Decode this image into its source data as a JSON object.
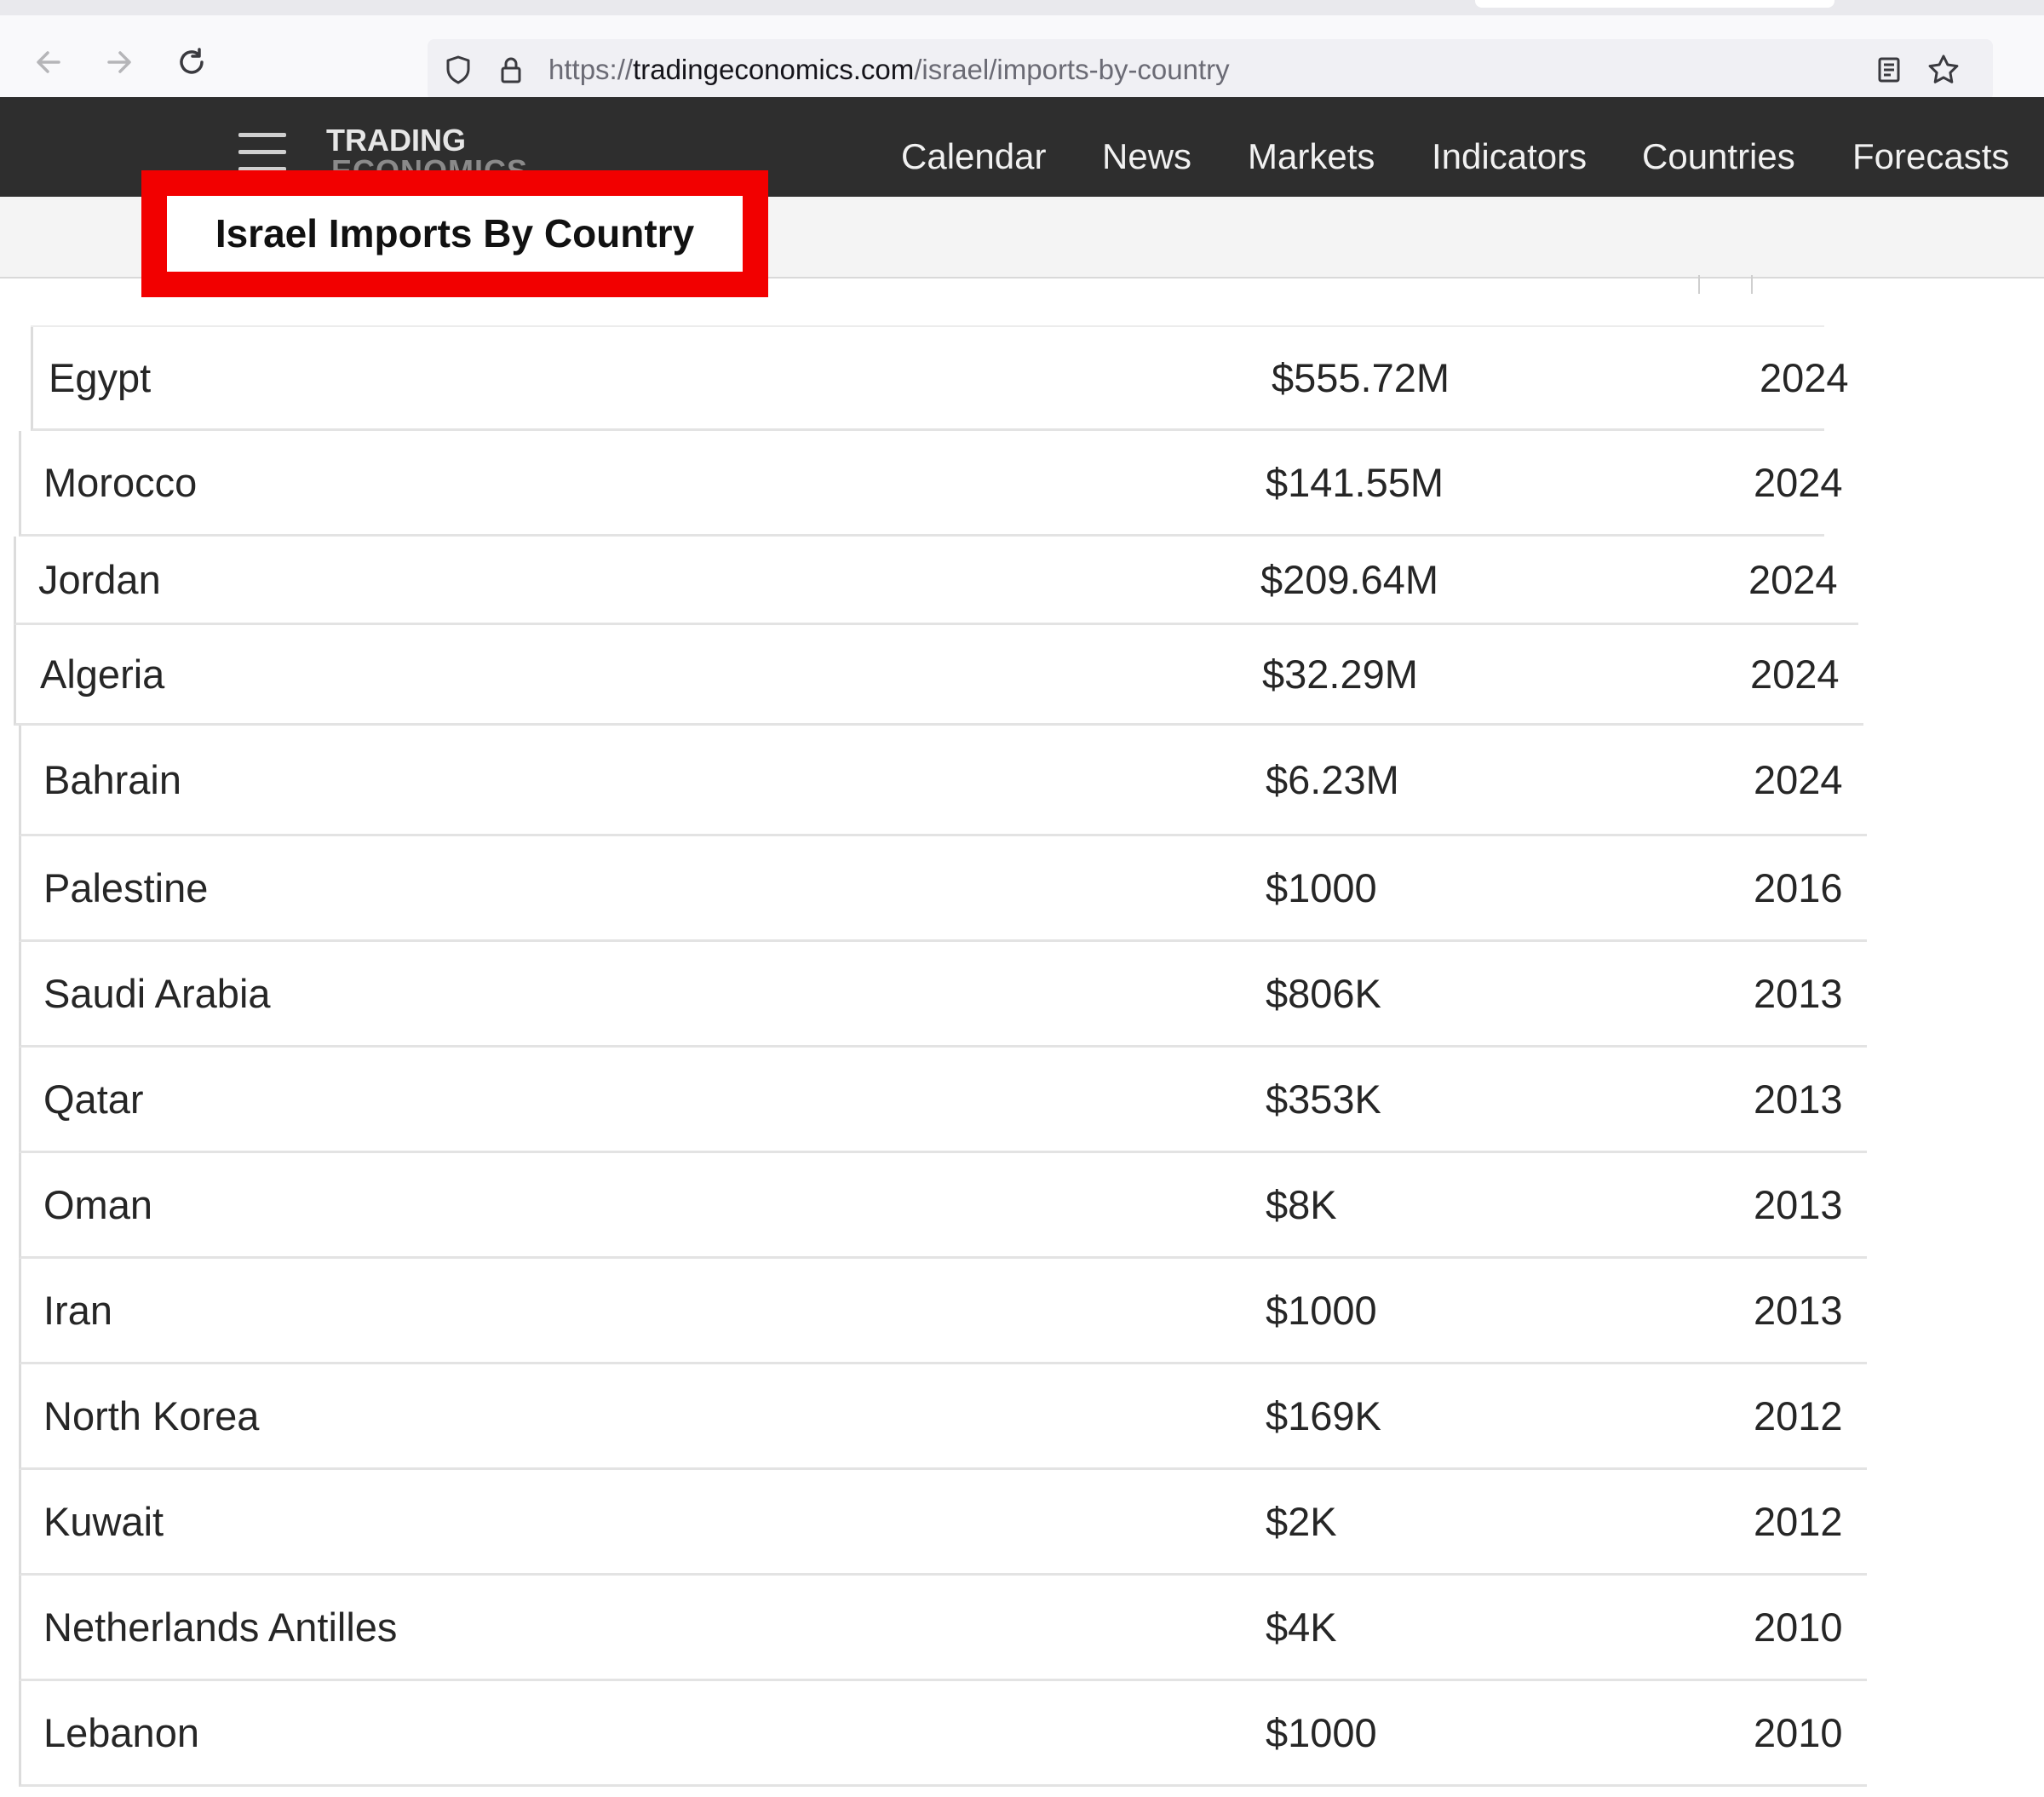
{
  "browser": {
    "url_scheme": "https://",
    "url_host": "tradingeconomics.com",
    "url_path": "/israel/imports-by-country"
  },
  "site": {
    "logo_line1": "TRADING",
    "logo_line2": "ECONOMICS",
    "nav": [
      "Calendar",
      "News",
      "Markets",
      "Indicators",
      "Countries",
      "Forecasts"
    ]
  },
  "page": {
    "title": "Israel Imports By Country",
    "highlight_color": "#f20000"
  },
  "table": {
    "rows": [
      {
        "country": "Egypt",
        "value": "$555.72M",
        "year": "2024"
      },
      {
        "country": "Morocco",
        "value": "$141.55M",
        "year": "2024"
      },
      {
        "country": "Jordan",
        "value": "$209.64M",
        "year": "2024"
      },
      {
        "country": "Algeria",
        "value": "$32.29M",
        "year": "2024"
      },
      {
        "country": "Bahrain",
        "value": "$6.23M",
        "year": "2024"
      },
      {
        "country": "Palestine",
        "value": "$1000",
        "year": "2016"
      },
      {
        "country": "Saudi Arabia",
        "value": "$806K",
        "year": "2013"
      },
      {
        "country": "Qatar",
        "value": "$353K",
        "year": "2013"
      },
      {
        "country": "Oman",
        "value": "$8K",
        "year": "2013"
      },
      {
        "country": "Iran",
        "value": "$1000",
        "year": "2013"
      },
      {
        "country": "North Korea",
        "value": "$169K",
        "year": "2012"
      },
      {
        "country": "Kuwait",
        "value": "$2K",
        "year": "2012"
      },
      {
        "country": "Netherlands Antilles",
        "value": "$4K",
        "year": "2010"
      },
      {
        "country": "Lebanon",
        "value": "$1000",
        "year": "2010"
      }
    ]
  }
}
